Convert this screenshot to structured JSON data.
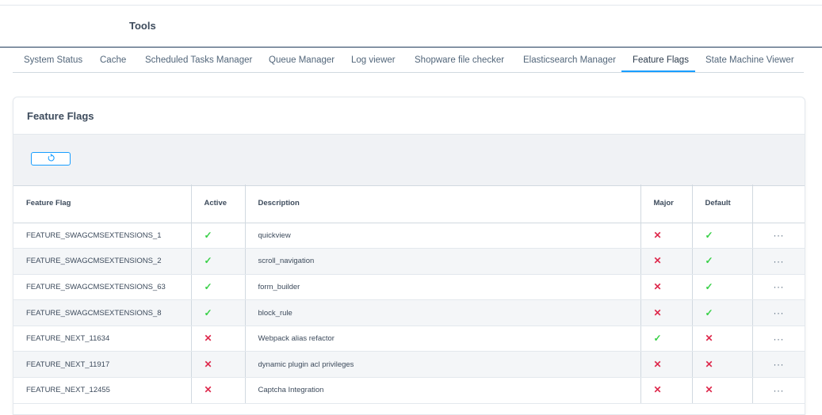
{
  "header": {
    "title": "Tools"
  },
  "tabs": [
    {
      "label": "System Status",
      "active": false
    },
    {
      "label": "Cache",
      "active": false
    },
    {
      "label": "Scheduled Tasks Manager",
      "active": false
    },
    {
      "label": "Queue Manager",
      "active": false
    },
    {
      "label": "Log viewer",
      "active": false
    },
    {
      "label": "Shopware file checker",
      "active": false
    },
    {
      "label": "Elasticsearch Manager",
      "active": false
    },
    {
      "label": "Feature Flags",
      "active": true
    },
    {
      "label": "State Machine Viewer",
      "active": false
    }
  ],
  "card": {
    "title": "Feature Flags"
  },
  "toolbar": {
    "reset_icon": "refresh-icon"
  },
  "table": {
    "columns": {
      "flag": "Feature Flag",
      "active": "Active",
      "description": "Description",
      "major": "Major",
      "default": "Default"
    },
    "rows": [
      {
        "flag": "FEATURE_SWAGCMSEXTENSIONS_1",
        "active": true,
        "description": "quickview",
        "major": false,
        "default": true
      },
      {
        "flag": "FEATURE_SWAGCMSEXTENSIONS_2",
        "active": true,
        "description": "scroll_navigation",
        "major": false,
        "default": true
      },
      {
        "flag": "FEATURE_SWAGCMSEXTENSIONS_63",
        "active": true,
        "description": "form_builder",
        "major": false,
        "default": true
      },
      {
        "flag": "FEATURE_SWAGCMSEXTENSIONS_8",
        "active": true,
        "description": "block_rule",
        "major": false,
        "default": true
      },
      {
        "flag": "FEATURE_NEXT_11634",
        "active": false,
        "description": "Webpack alias refactor",
        "major": true,
        "default": false
      },
      {
        "flag": "FEATURE_NEXT_11917",
        "active": false,
        "description": "dynamic plugin acl privileges",
        "major": false,
        "default": false
      },
      {
        "flag": "FEATURE_NEXT_12455",
        "active": false,
        "description": "Captcha Integration",
        "major": false,
        "default": false
      }
    ],
    "context_menu_label": "···",
    "check_symbol": "✓",
    "cross_symbol": "✕"
  },
  "colors": {
    "accent": "#189eff",
    "success": "#37d046",
    "danger": "#de294c"
  }
}
